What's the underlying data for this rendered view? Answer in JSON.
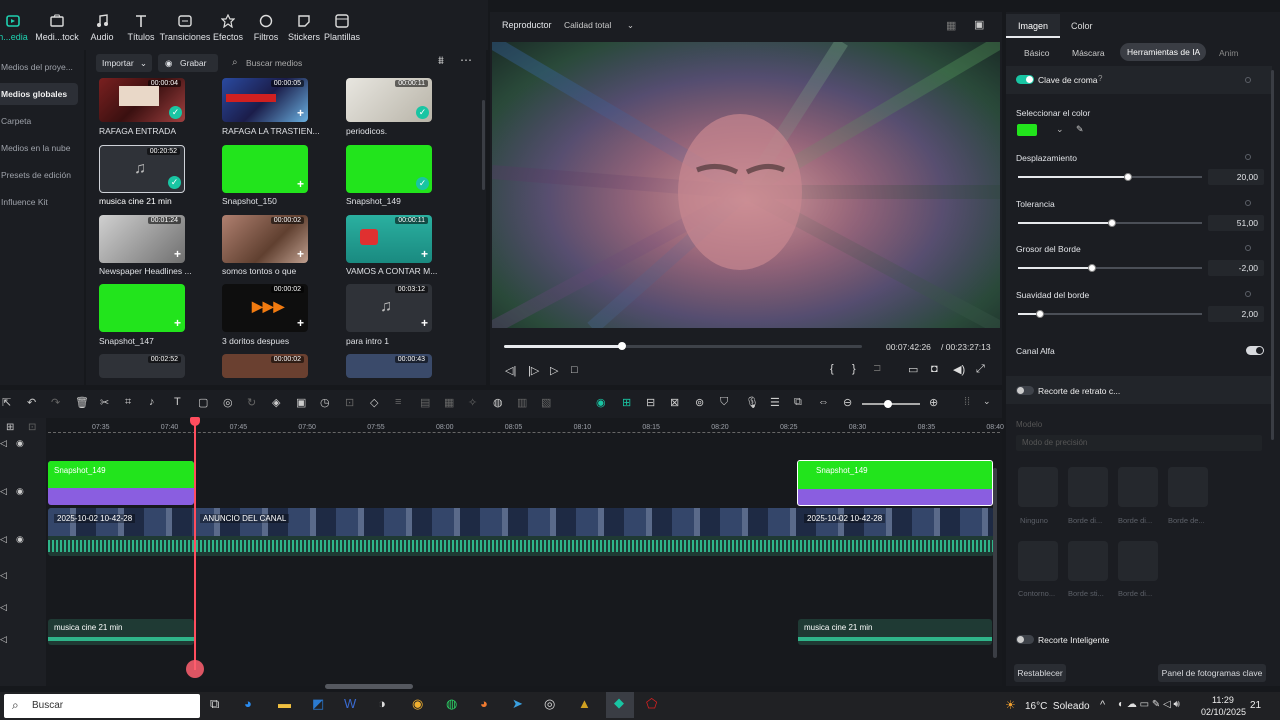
{
  "toolbar": {
    "items": [
      {
        "label": "h...edia",
        "icon": "media-icon"
      },
      {
        "label": "Medi...tock",
        "icon": "stock-icon"
      },
      {
        "label": "Audio",
        "icon": "music-icon"
      },
      {
        "label": "Títulos",
        "icon": "title-icon"
      },
      {
        "label": "Transiciones",
        "icon": "transition-icon"
      },
      {
        "label": "Efectos",
        "icon": "effects-icon"
      },
      {
        "label": "Filtros",
        "icon": "filter-icon"
      },
      {
        "label": "Stickers",
        "icon": "sticker-icon"
      },
      {
        "label": "Plantillas",
        "icon": "template-icon"
      }
    ]
  },
  "leftnav": {
    "items": [
      "Medios del proye...",
      "Medios globales",
      "Carpeta",
      "Medios en la nube",
      "Presets de edición",
      "Influence Kit"
    ],
    "active_index": 1
  },
  "media": {
    "import_label": "Importar",
    "record_label": "Grabar",
    "search_placeholder": "Buscar medios",
    "items": [
      {
        "name": "RAFAGA ENTRADA",
        "duration": "00:00:04",
        "kind": "video",
        "checked": true
      },
      {
        "name": "RAFAGA LA TRASTIEN...",
        "duration": "00:00:05",
        "kind": "video",
        "checked": false
      },
      {
        "name": "periodicos.",
        "duration": "00:00:11",
        "kind": "image",
        "checked": true
      },
      {
        "name": "musica cine 21 min",
        "duration": "00:20:52",
        "kind": "audio",
        "checked": true
      },
      {
        "name": "Snapshot_150",
        "duration": "",
        "kind": "green",
        "checked": false
      },
      {
        "name": "Snapshot_149",
        "duration": "",
        "kind": "green",
        "checked": true
      },
      {
        "name": "Newspaper Headlines ...",
        "duration": "00:01:24",
        "kind": "image",
        "checked": false
      },
      {
        "name": "somos tontos o que",
        "duration": "00:00:02",
        "kind": "video",
        "checked": false
      },
      {
        "name": "VAMOS A CONTAR M...",
        "duration": "00:00:11",
        "kind": "video",
        "checked": false
      },
      {
        "name": "Snapshot_147",
        "duration": "",
        "kind": "green",
        "checked": false
      },
      {
        "name": "3 doritos despues",
        "duration": "00:00:02",
        "kind": "video",
        "checked": false
      },
      {
        "name": "para intro 1",
        "duration": "00:03:12",
        "kind": "audio",
        "checked": false
      }
    ],
    "partial_durations": [
      "00:02:52",
      "00:00:02",
      "00:00:43"
    ]
  },
  "player": {
    "label": "Reproductor",
    "quality": "Calidad total",
    "current_time": "00:07:42:26",
    "total_time": "/ 00:23:27:13",
    "progress": 0.33
  },
  "rpanel": {
    "tabs": [
      "Imagen",
      "Color"
    ],
    "subtabs": [
      "Básico",
      "Máscara",
      "Herramientas de IA",
      "Anim"
    ],
    "chroma_label": "Clave de croma",
    "select_color_label": "Seleccionar el color",
    "swatch_color": "#22e41c",
    "sliders": [
      {
        "label": "Desplazamiento",
        "value": "20,00",
        "fraction": 0.6
      },
      {
        "label": "Tolerancia",
        "value": "51,00",
        "fraction": 0.51
      },
      {
        "label": "Grosor del Borde",
        "value": "-2,00",
        "fraction": 0.4
      },
      {
        "label": "Suavidad del borde",
        "value": "2,00",
        "fraction": 0.12
      }
    ],
    "alpha_label": "Canal Alfa",
    "portrait_label": "Recorte de retrato c...",
    "model_label": "Modelo",
    "precision_label": "Modo de precisión",
    "ai_tiles": [
      "Ninguno",
      "Borde di...",
      "Borde di...",
      "Borde de...",
      "Contorno...",
      "Borde sti...",
      "Borde di..."
    ],
    "smart_cut_label": "Recorte Inteligente",
    "reset_label": "Restablecer",
    "keyframe_label": "Panel de fotogramas clave"
  },
  "timeline": {
    "ticks": [
      "07:35",
      "07:40",
      "07:45",
      "07:50",
      "07:55",
      "08:00",
      "08:05",
      "08:10",
      "08:15",
      "08:20",
      "08:25",
      "08:30",
      "08:35",
      "08:40"
    ],
    "clips": {
      "snapshot_left": "Snapshot_149",
      "snapshot_right": "Snapshot_149",
      "video1": "2025-10-02 10-42-28",
      "video2": "ANUNCIO DEL CANAL",
      "video3": "2025-10-02 10-42-28",
      "music_left": "musica cine 21 min",
      "music_right": "musica cine 21 min"
    }
  },
  "taskbar": {
    "search_placeholder": "Buscar",
    "weather": "16°C  Soleado",
    "time": "11:29",
    "date": "02/10/2025",
    "notifications": "21"
  }
}
